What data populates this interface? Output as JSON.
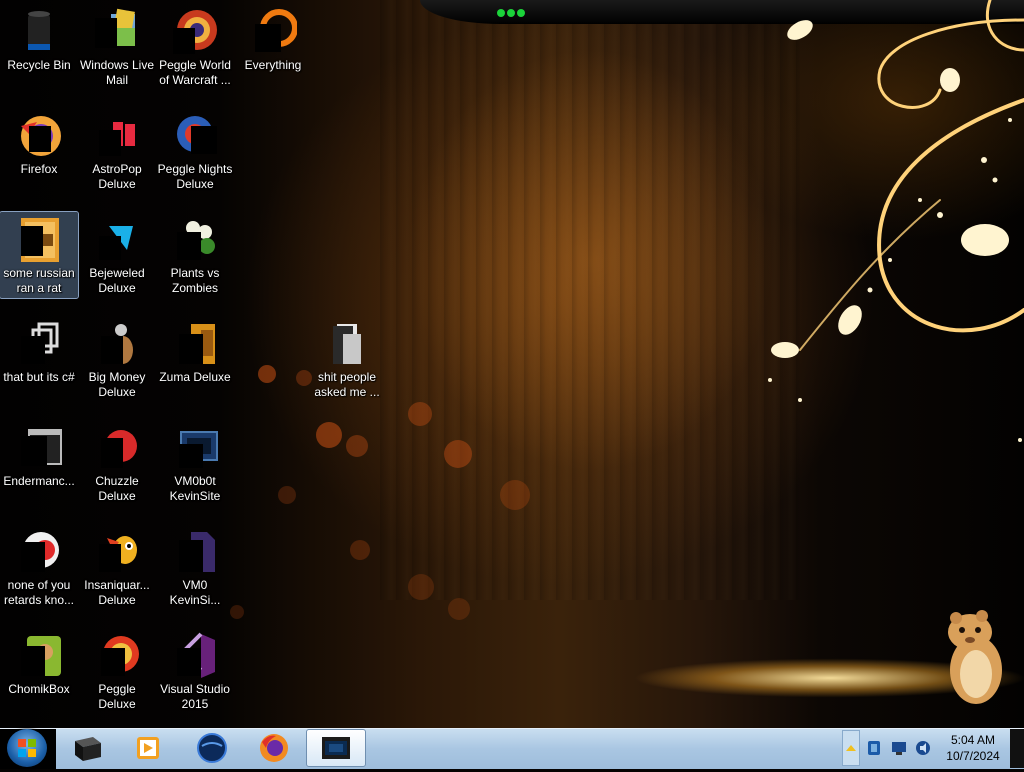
{
  "desktop": {
    "icons": [
      {
        "label": "Recycle Bin",
        "icon": "recycle-bin-icon"
      },
      {
        "label": "Windows Live Mail",
        "icon": "mail-icon"
      },
      {
        "label": "Peggle World of Warcraft ...",
        "icon": "peggle-icon"
      },
      {
        "label": "Everything",
        "icon": "everything-icon"
      },
      {
        "label": "Firefox",
        "icon": "firefox-icon"
      },
      {
        "label": "AstroPop Deluxe",
        "icon": "astropop-icon"
      },
      {
        "label": "Peggle Nights Deluxe",
        "icon": "peggle-icon"
      },
      {
        "label": "some russian ran a rat",
        "icon": "image-file-icon"
      },
      {
        "label": "Bejeweled Deluxe",
        "icon": "bejeweled-icon"
      },
      {
        "label": "Plants vs Zombies",
        "icon": "plants-icon"
      },
      {
        "label": "that but its c#",
        "icon": "shortcut-icon"
      },
      {
        "label": "Big Money Deluxe",
        "icon": "big-money-icon"
      },
      {
        "label": "Zuma Deluxe",
        "icon": "zuma-icon"
      },
      {
        "label": "shit people asked me ...",
        "icon": "folder-icon"
      },
      {
        "label": "Endermanc...",
        "icon": "terminal-icon"
      },
      {
        "label": "Chuzzle Deluxe",
        "icon": "chuzzle-icon"
      },
      {
        "label": "VM0b0t KevinSite",
        "icon": "vm-icon"
      },
      {
        "label": "none of you retards kno...",
        "icon": "app-icon"
      },
      {
        "label": "Insaniquar... Deluxe",
        "icon": "fish-icon"
      },
      {
        "label": "VM0 KevinSi...",
        "icon": "file-icon"
      },
      {
        "label": "ChomikBox",
        "icon": "chomikbox-icon"
      },
      {
        "label": "Peggle Deluxe",
        "icon": "peggle-icon"
      },
      {
        "label": "Visual Studio 2015",
        "icon": "visual-studio-icon"
      }
    ]
  },
  "taskbar": {
    "buttons": [
      {
        "icon": "terminal-icon"
      },
      {
        "icon": "media-player-icon"
      },
      {
        "icon": "globe-icon"
      },
      {
        "icon": "firefox-icon"
      },
      {
        "icon": "vm-window-icon"
      }
    ],
    "clock": {
      "time": "5:04 AM",
      "date": "10/7/2024"
    }
  },
  "colors": {
    "taskbar": "#a9c6e2",
    "wallpaper_accent": "#e0a030"
  }
}
